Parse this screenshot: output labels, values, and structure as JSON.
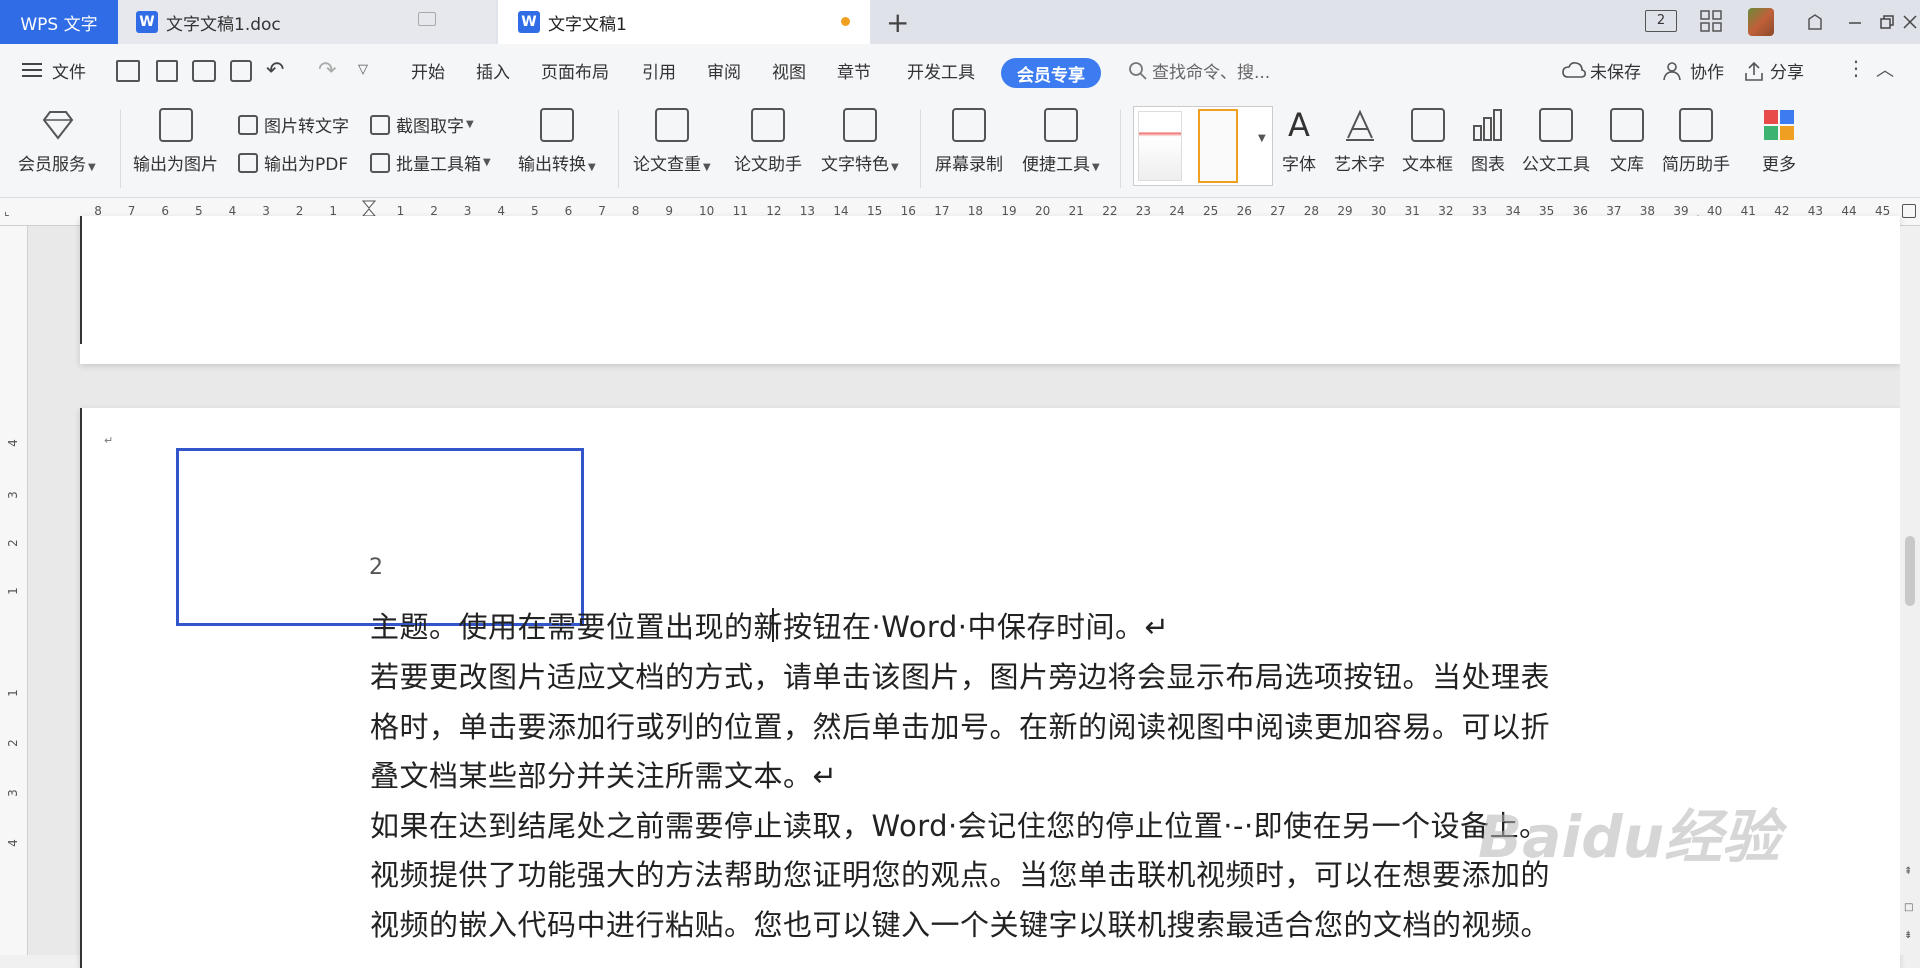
{
  "tabs": {
    "app": "WPS 文字",
    "doc1": "文字文稿1.doc",
    "doc2": "文字文稿1",
    "add": "+"
  },
  "window": {
    "badge": "2"
  },
  "menu": {
    "file": "文件",
    "items": [
      "开始",
      "插入",
      "页面布局",
      "引用",
      "审阅",
      "视图",
      "章节",
      "开发工具"
    ],
    "vip": "会员专享",
    "search_placeholder": "查找命令、搜...",
    "unsaved": "未保存",
    "collab": "协作",
    "share": "分享"
  },
  "ribbon": {
    "member_service": "会员服务",
    "export_image": "输出为图片",
    "img_to_text": "图片转文字",
    "export_pdf": "输出为PDF",
    "screenshot_text": "截图取字",
    "batch_tools": "批量工具箱",
    "export_convert": "输出转换",
    "thesis_check": "论文查重",
    "thesis_helper": "论文助手",
    "text_feature": "文字特色",
    "screen_record": "屏幕录制",
    "quick_tools": "便捷工具",
    "font": "字体",
    "art_text": "艺术字",
    "text_box": "文本框",
    "chart": "图表",
    "official_tools": "公文工具",
    "library": "文库",
    "resume_helper": "简历助手",
    "more": "更多"
  },
  "ruler": {
    "left_numbers": [
      "8",
      "7",
      "6",
      "5",
      "4",
      "3",
      "2",
      "1"
    ],
    "right_numbers": [
      "1",
      "2",
      "3",
      "4",
      "5",
      "6",
      "7",
      "8",
      "9",
      "10",
      "11",
      "12",
      "13",
      "14",
      "15",
      "16",
      "17",
      "18",
      "19",
      "20",
      "21",
      "22",
      "23",
      "24",
      "25",
      "26",
      "27",
      "28",
      "29",
      "30",
      "31",
      "32",
      "33",
      "34",
      "35",
      "36",
      "37",
      "38",
      "39",
      "40",
      "41",
      "42",
      "43",
      "44",
      "45"
    ],
    "vertical_numbers": [
      "4",
      "3",
      "2",
      "1",
      "1",
      "2",
      "3",
      "4"
    ]
  },
  "document": {
    "box_number": "2",
    "lines": [
      "主题。使用在需要位置出现的新按钮在·Word·中保存时间。↵",
      "若要更改图片适应文档的方式，请单击该图片，图片旁边将会显示布局选项按钮。当处理表",
      "格时，单击要添加行或列的位置，然后单击加号。在新的阅读视图中阅读更加容易。可以折",
      "叠文档某些部分并关注所需文本。↵",
      "如果在达到结尾处之前需要停止读取，Word·会记住您的停止位置·-·即使在另一个设备上。",
      "视频提供了功能强大的方法帮助您证明您的观点。当您单击联机视频时，可以在想要添加的",
      "视频的嵌入代码中进行粘贴。您也可以键入一个关键字以联机搜索最适合您的文档的视频。"
    ],
    "para_mark": "↵"
  },
  "watermark": "Baidu经验",
  "colors": {
    "accent": "#2f6ce5",
    "vip": "#3d7cf0",
    "box_border": "#3355cc"
  }
}
